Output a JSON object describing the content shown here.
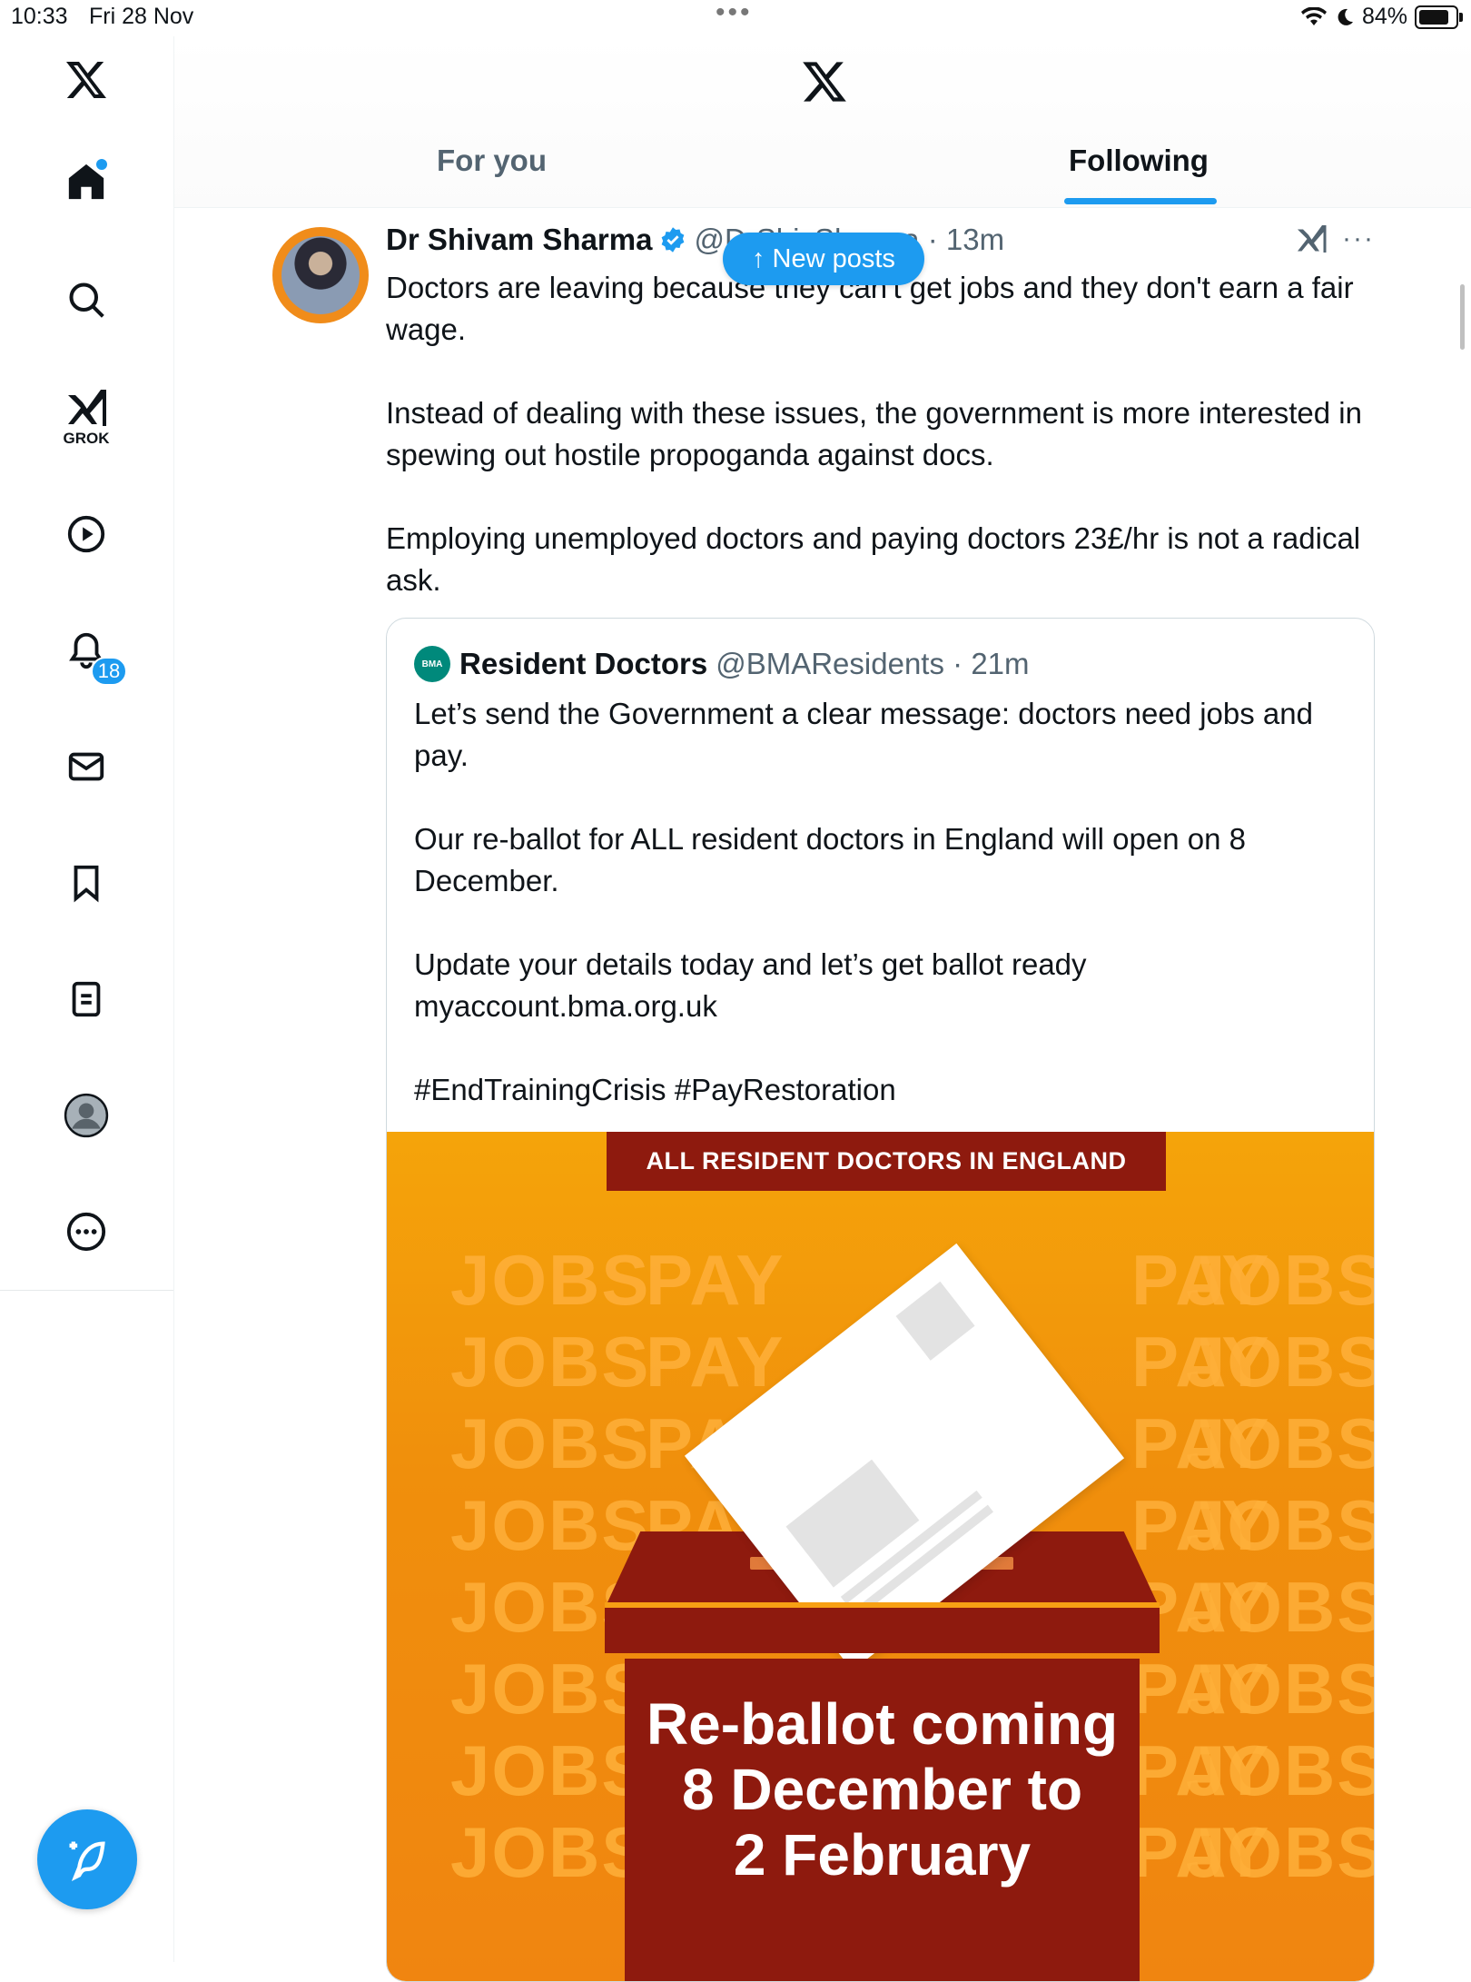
{
  "status": {
    "time": "10:33",
    "date": "Fri 28 Nov",
    "battery": "84%",
    "battery_level": 0.84
  },
  "sidebar": {
    "grok_label": "GROK",
    "notifications_count": "18"
  },
  "header": {
    "tabs": [
      {
        "label": "For you"
      },
      {
        "label": "Following"
      }
    ],
    "active_tab": "Following"
  },
  "new_posts_label": "New posts",
  "post": {
    "author": "Dr Shivam Sharma",
    "handle": "@DrShivSharma",
    "time": "13m",
    "text": "Doctors are leaving because they can't get jobs and they don't earn a fair wage.\n\nInstead of dealing with these issues, the government is more interested in spewing out hostile propoganda against docs.\n\nEmploying unemployed doctors and paying doctors 23£/hr is not a radical ask."
  },
  "quote": {
    "avatar_label": "BMA",
    "author": "Resident Doctors",
    "handle": "@BMAResidents",
    "time": "21m",
    "text": "Let’s send the Government a clear message: doctors need jobs and pay.\n\nOur re-ballot for ALL resident doctors in England will open on 8 December.\n\nUpdate your details today and let’s get ballot ready myaccount.bma.org.uk\n\n#EndTrainingCrisis #PayRestoration",
    "image": {
      "banner": "ALL RESIDENT DOCTORS IN ENGLAND",
      "headline_lines": [
        "Re-ballot coming",
        "8 December to",
        "2 February"
      ],
      "watermark_words": [
        "JOBS",
        "PAY"
      ]
    }
  },
  "colors": {
    "accent": "#1d9bf0",
    "text": "#0f1419",
    "muted": "#536471",
    "maroon": "#8e1a0e",
    "orange": "#f39a0c"
  }
}
